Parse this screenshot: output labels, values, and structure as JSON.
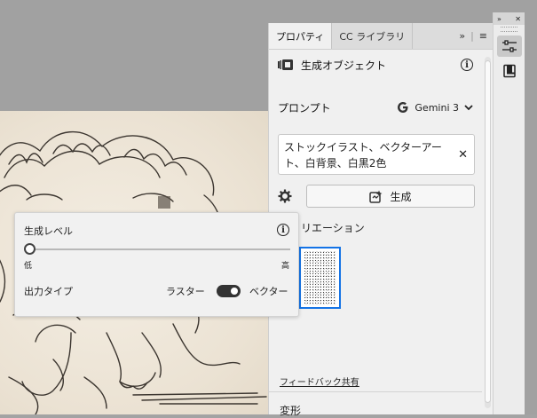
{
  "panel": {
    "tabs": [
      {
        "label": "プロパティ",
        "active": true
      },
      {
        "label": "CC ライブラリ",
        "active": false
      }
    ],
    "tab_tools": {
      "expand": "»",
      "menu": "≡"
    },
    "section_title": "生成オブジェクト",
    "prompt_label": "プロンプト",
    "model_name": "Gemini 3",
    "prompt_text": "ストックイラスト、ベクターアート、白背景、白黒2色",
    "clear_glyph": "✕",
    "generate_label": "生成",
    "variations_label": "リエーション",
    "feedback_label": "フィードバック共有",
    "transform_label": "変形"
  },
  "popover": {
    "title": "生成レベル",
    "slider_low": "低",
    "slider_high": "高",
    "slider_value": 0.0,
    "output_type_label": "出力タイプ",
    "raster_label": "ラスター",
    "vector_label": "ベクター",
    "vector_selected": true
  },
  "toolstrip": {
    "collapse": "»",
    "close": "✕"
  },
  "colors": {
    "accent": "#1473e6",
    "panel_bg": "#f0f0f0",
    "canvas_bg": "#a1a1a1",
    "paper": "#efe8dc"
  }
}
